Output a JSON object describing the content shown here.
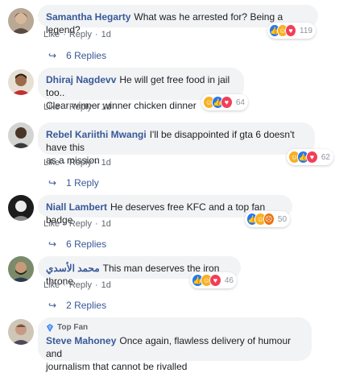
{
  "comments": [
    {
      "author": "Samantha Hegarty",
      "text": "What was he arrested for? Being a legend?",
      "actions": {
        "like": "Like",
        "reply": "Reply",
        "time": "1d"
      },
      "reactions": {
        "icons": [
          "like",
          "haha",
          "love"
        ],
        "count": "119"
      },
      "replies": "6 Replies"
    },
    {
      "author": "Dhiraj Nagdevv",
      "text_line1": "He will get free food in jail too..",
      "text_line2": "Clear winner winner chicken dinner",
      "actions": {
        "like": "Like",
        "reply": "Reply",
        "time": "1d"
      },
      "reactions": {
        "icons": [
          "haha",
          "like",
          "love"
        ],
        "count": "64"
      }
    },
    {
      "author": "Rebel Kariithi Mwangi",
      "text_line1": "I'll be disappointed if gta 6 doesn't have this",
      "text_line2": "as a mission",
      "actions": {
        "like": "Like",
        "reply": "Reply",
        "time": "1d"
      },
      "reactions": {
        "icons": [
          "haha",
          "like",
          "love"
        ],
        "count": "62"
      },
      "replies": "1 Reply"
    },
    {
      "author": "Niall Lambert",
      "text": "He deserves free KFC and a top fan badge",
      "actions": {
        "like": "Like",
        "reply": "Reply",
        "time": "1d"
      },
      "reactions": {
        "icons": [
          "like",
          "haha",
          "angry"
        ],
        "count": "50"
      },
      "replies": "6 Replies"
    },
    {
      "author": "محمد الأسدي",
      "text": "This man deserves the iron throne.",
      "actions": {
        "like": "Like",
        "reply": "Reply",
        "time": "1d"
      },
      "reactions": {
        "icons": [
          "like",
          "haha",
          "love"
        ],
        "count": "46"
      },
      "replies": "2 Replies"
    },
    {
      "badge": "Top Fan",
      "author": "Steve Mahoney",
      "text_line1": "Once again, flawless delivery of humour and",
      "text_line2": "journalism that cannot be rivalled"
    }
  ],
  "colors": {
    "author": "#385898",
    "bubble": "#f2f3f5",
    "meta": "#606770",
    "like": "#2078f4",
    "haha": "#f7b125",
    "love": "#f33e58",
    "angry": "#e9710f"
  },
  "icons": {
    "reply_arrow": "reply-arrow-icon",
    "like": "thumbs-up-icon",
    "haha": "laughing-face-icon",
    "love": "heart-icon",
    "angry": "angry-face-icon",
    "top_fan": "top-fan-badge-icon"
  }
}
